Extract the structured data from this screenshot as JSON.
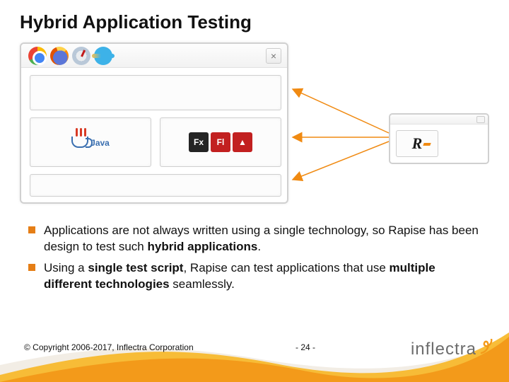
{
  "title": "Hybrid Application Testing",
  "diagram": {
    "browsers": [
      "chrome",
      "firefox",
      "safari",
      "ie"
    ],
    "java_label": "Java",
    "fx_label": "Fx",
    "fl_label": "Fl",
    "air_glyph": "▲",
    "rapise_logo": "R"
  },
  "bullets": [
    {
      "pre": "Applications are not always written using a single technology, so Rapise has been design to test such ",
      "bold": "hybrid applications",
      "post": "."
    },
    {
      "pre": "Using a ",
      "bold": "single test script",
      "mid": ", Rapise can test applications that use ",
      "bold2": "multiple different technologies",
      "post": " seamlessly."
    }
  ],
  "footer": {
    "copyright": "© Copyright 2006-2017, Inflectra Corporation",
    "page": "- 24 -",
    "brand": "inflectra"
  }
}
